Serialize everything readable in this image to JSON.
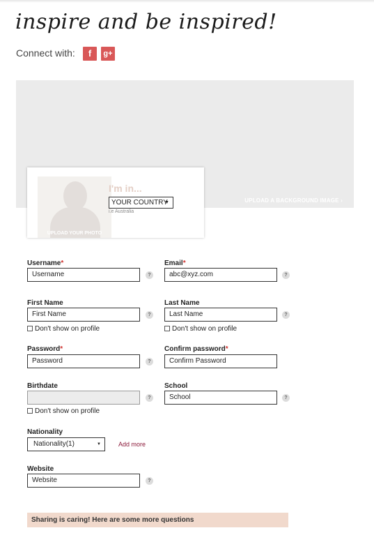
{
  "header": {
    "tagline": "inspire and be inspired!",
    "connect_label": "Connect with:",
    "facebook_glyph": "f",
    "google_glyph": "g+"
  },
  "banner": {
    "upload_bg_label": "UPLOAD A BACKGROUND IMAGE ›"
  },
  "profile": {
    "upload_photo_label": "UPLOAD YOUR PHOTO",
    "im_in": "I'm in...",
    "country_value": "YOUR COUNTRY",
    "country_hint": "i.e Australia"
  },
  "form": {
    "username": {
      "label": "Username",
      "required": "*",
      "placeholder": "Username",
      "help": "?"
    },
    "email": {
      "label": "Email",
      "required": "*",
      "value": "abc@xyz.com",
      "help": "?"
    },
    "first_name": {
      "label": "First Name",
      "placeholder": "First Name",
      "help": "?",
      "checkbox": "Don't show on profile"
    },
    "last_name": {
      "label": "Last Name",
      "placeholder": "Last Name",
      "help": "?",
      "checkbox": "Don't show on profile"
    },
    "password": {
      "label": "Password",
      "required": "*",
      "placeholder": "Password",
      "help": "?"
    },
    "confirm_password": {
      "label": "Confirm password",
      "required": "*",
      "placeholder": "Confirm Password"
    },
    "birthdate": {
      "label": "Birthdate",
      "help": "?",
      "checkbox": "Don't show on profile"
    },
    "school": {
      "label": "School",
      "placeholder": "School",
      "help": "?"
    },
    "nationality": {
      "label": "Nationality",
      "value": "Nationality(1)",
      "add_more": "Add more"
    },
    "website": {
      "label": "Website",
      "placeholder": "Website",
      "help": "?"
    }
  },
  "sharing_banner": "Sharing is caring! Here are some more questions",
  "colors": {
    "accent": "#d95858",
    "banner_bg": "#ebebeb",
    "sharing_bg": "#f1d9cc",
    "required": "#d0312d",
    "link": "#8b1a3a"
  }
}
